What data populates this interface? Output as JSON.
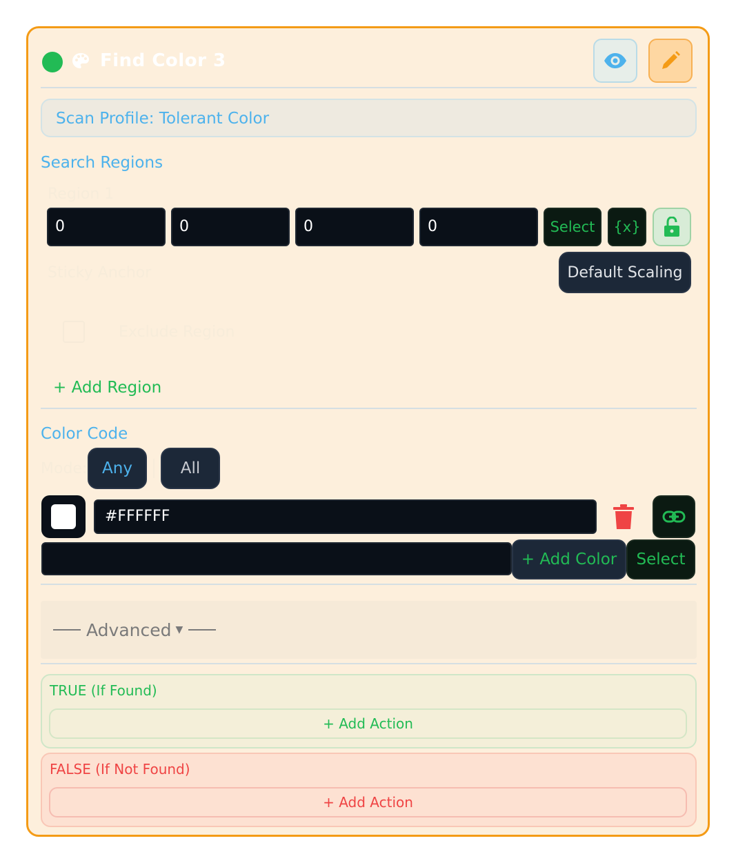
{
  "node": {
    "title": "Find Color 3",
    "status_color": "#22bb55",
    "accent": "#f49b16"
  },
  "header": {
    "eye_icon": "eye-icon",
    "edit_icon": "pencil-icon",
    "palette_icon": "palette-icon"
  },
  "scan_profile": {
    "label": "Scan Profile: Tolerant Color"
  },
  "search_regions": {
    "title": "Search Regions",
    "region_label": "Region 1",
    "x": "0",
    "y": "0",
    "w": "0",
    "h": "0",
    "select_label": "Select",
    "var_label": "{x}",
    "lock_icon": "unlock-icon",
    "sticky_anchor_label": "Sticky Anchor",
    "scaling_label": "Default Scaling",
    "exclude_label": "Exclude Region",
    "add_region_label": "+ Add Region"
  },
  "color_code": {
    "title": "Color Code",
    "mode_label": "Mode:",
    "mode_any": "Any",
    "mode_all": "All",
    "swatch_color": "#FFFFFF",
    "hex_value": "#FFFFFF",
    "delete_icon": "trash-icon",
    "link_icon": "link-icon",
    "new_color_value": "",
    "add_color_label": "+ Add Color",
    "select_label": "Select"
  },
  "advanced": {
    "label": "Advanced"
  },
  "branches": {
    "true_label": "TRUE (If Found)",
    "true_add_action": "+ Add Action",
    "false_label": "FALSE (If Not Found)",
    "false_add_action": "+ Add Action"
  }
}
